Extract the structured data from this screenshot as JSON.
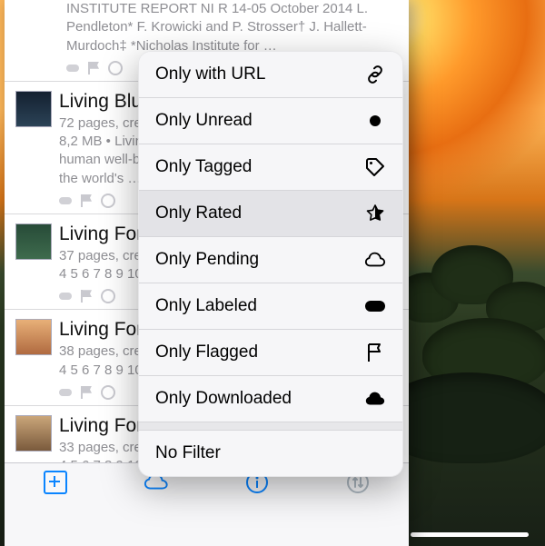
{
  "panel": {
    "items": [
      {
        "title": "",
        "meta": "INSTITUTE REPORT NI R 14-05 October 2014 L. Pendleton* F. Krowicki and P. Strosser† J. Hallett-Murdoch‡ *Nicholas Institute for …"
      },
      {
        "title": "Living Blu",
        "meta": "72 pages, crea\n8,2 MB • Livin\nhuman well-b\nthe world's …"
      },
      {
        "title": "Living For",
        "meta": "37 pages, crea\n4 5 6 7 8 9 10"
      },
      {
        "title": "Living For",
        "meta": "38 pages, crea\n4 5 6 7 8 9 10"
      },
      {
        "title": "Living For",
        "meta": "33 pages, crea\n4 5 6 7 8 9 10"
      }
    ]
  },
  "popover": {
    "rows": {
      "url": "Only with URL",
      "unread": "Only Unread",
      "tagged": "Only Tagged",
      "rated": "Only Rated",
      "pending": "Only Pending",
      "labeled": "Only Labeled",
      "flagged": "Only Flagged",
      "downloaded": "Only Downloaded",
      "nofilter": "No Filter"
    }
  }
}
